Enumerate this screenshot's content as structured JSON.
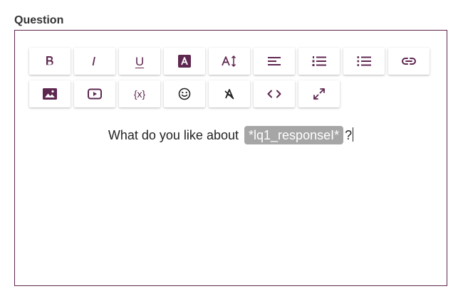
{
  "field": {
    "label": "Question"
  },
  "toolbar": {
    "underline_glyph": "U",
    "variable_glyph": "{x}"
  },
  "editor": {
    "text_before": "What do you like about",
    "token_text": "*lq1_responseI*",
    "text_after": "?"
  },
  "colors": {
    "accent": "#5e2750",
    "token_background": "#a6a6a6",
    "border": "#5e2750"
  },
  "icons": [
    "bold-icon",
    "italic-icon",
    "underline-icon",
    "text-color-icon",
    "font-size-icon",
    "align-icon",
    "ordered-list-icon",
    "unordered-list-icon",
    "link-icon",
    "image-icon",
    "video-icon",
    "variable-icon",
    "emoji-icon",
    "clear-format-icon",
    "code-view-icon",
    "fullscreen-icon"
  ]
}
